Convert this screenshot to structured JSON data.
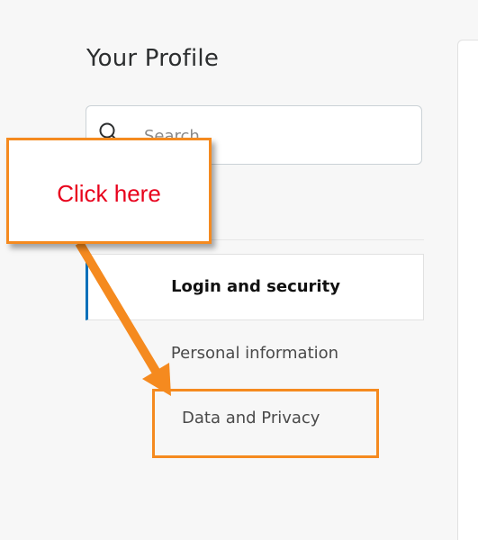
{
  "profile": {
    "title": "Your Profile"
  },
  "search": {
    "placeholder": "Search"
  },
  "nav": {
    "items": [
      {
        "label": "Login and security",
        "active": true
      },
      {
        "label": "Personal information",
        "active": false
      },
      {
        "label": "Data and Privacy",
        "active": false
      }
    ]
  },
  "annotation": {
    "callout_text": "Click here",
    "color": "#f58a1f",
    "text_color": "#e8001c"
  },
  "colors": {
    "active_accent": "#0070ba"
  }
}
